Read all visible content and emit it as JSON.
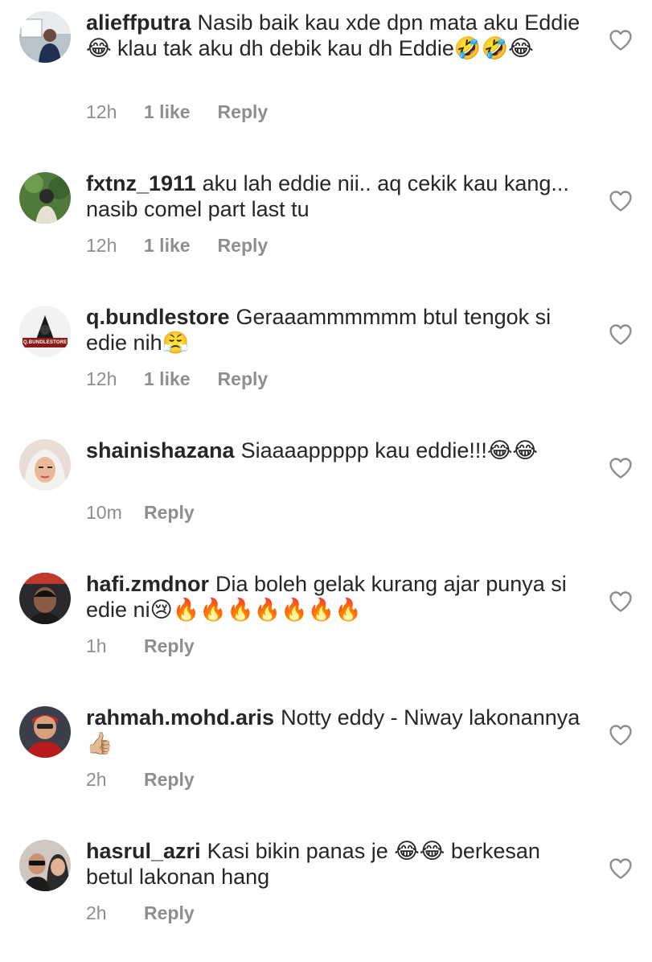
{
  "comments": [
    {
      "username": "alieffputra",
      "text": "Nasib baik kau xde dpn mata aku Eddie😂 klau tak aku dh debik kau dh Eddie🤣🤣😂",
      "time": "12h",
      "likes": "1 like",
      "reply": "Reply"
    },
    {
      "username": "fxtnz_1911",
      "text": "aku lah eddie nii.. aq cekik kau kang... nasib comel part last tu",
      "time": "12h",
      "likes": "1 like",
      "reply": "Reply"
    },
    {
      "username": "q.bundlestore",
      "text": "Geraaammmmmm btul tengok si edie nih😤",
      "time": "12h",
      "likes": "1 like",
      "reply": "Reply",
      "avatar_text": "Q.BUNDLESTORE"
    },
    {
      "username": "shainishazana",
      "text": "Siaaaappppp kau eddie!!!😂😂",
      "time": "10m",
      "likes": "",
      "reply": "Reply"
    },
    {
      "username": "hafi.zmdnor",
      "text": "Dia boleh gelak  kurang ajar punya si edie ni😢🔥🔥🔥🔥🔥🔥🔥",
      "time": "1h",
      "likes": "",
      "reply": "Reply"
    },
    {
      "username": "rahmah.mohd.aris",
      "text": "Notty eddy - Niway lakonannya 👍🏼",
      "time": "2h",
      "likes": "",
      "reply": "Reply"
    },
    {
      "username": "hasrul_azri",
      "text": "Kasi bikin panas je 😂😂 berkesan betul lakonan hang",
      "time": "2h",
      "likes": "",
      "reply": "Reply"
    }
  ],
  "icons": {
    "like": "heart-outline-icon"
  },
  "colors": {
    "text": "#262626",
    "meta": "#8e8e8e",
    "background": "#ffffff"
  }
}
